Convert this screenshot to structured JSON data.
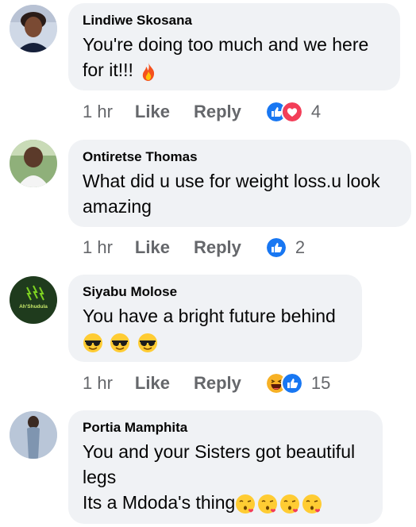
{
  "comments": [
    {
      "author": "Lindiwe Skosana",
      "lines": [
        "You're doing too much and we here",
        "for it!!!"
      ],
      "emojis": [
        "fire"
      ],
      "time": "1 hr",
      "like_label": "Like",
      "reply_label": "Reply",
      "reactions": [
        "like",
        "love"
      ],
      "reaction_count": "4"
    },
    {
      "author": "Ontiretse Thomas",
      "lines": [
        "What did u use for weight loss.u look",
        "amazing"
      ],
      "time": "1 hr",
      "like_label": "Like",
      "reply_label": "Reply",
      "reactions": [
        "like"
      ],
      "reaction_count": "2"
    },
    {
      "author": "Siyabu Molose",
      "lines": [
        "You have a bright future behind"
      ],
      "emojis": [
        "sunglasses",
        "sunglasses",
        "sunglasses"
      ],
      "time": "1 hr",
      "like_label": "Like",
      "reply_label": "Reply",
      "reactions": [
        "haha",
        "like"
      ],
      "reaction_count": "15"
    },
    {
      "author": "Portia Mamphita",
      "lines": [
        "You and your Sisters got beautiful",
        "legs",
        "Its a Mdoda's thing"
      ],
      "emojis": [
        "kiss",
        "kiss",
        "kiss",
        "kiss"
      ]
    }
  ],
  "avatar_text": "Ah'Shudula",
  "colors": {
    "like": "#1877f2",
    "love": "#f33e58",
    "haha": "#f7b125",
    "bubble": "#f0f2f5",
    "meta": "#65676b"
  }
}
